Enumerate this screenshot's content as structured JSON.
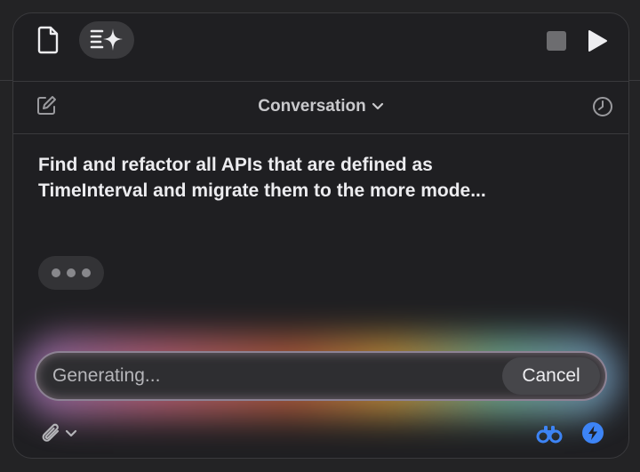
{
  "toolbar": {
    "left_icons": [
      "document-icon",
      "sparkle-text-icon"
    ],
    "right_icons": [
      "stop-icon",
      "play-icon"
    ]
  },
  "subbar": {
    "title": "Conversation",
    "left_icon": "compose-icon",
    "right_icon": "history-icon"
  },
  "conversation": {
    "message": "Find and refactor all APIs that are defined as\nTimeInterval and migrate them to the more mode..."
  },
  "input": {
    "status_text": "Generating...",
    "cancel_label": "Cancel"
  },
  "bottom": {
    "left_icons": [
      "paperclip-icon",
      "chevron-down-icon"
    ],
    "right_icons": [
      "binoculars-icon",
      "bolt-icon"
    ]
  },
  "colors": {
    "panel_bg": "#1f1f22",
    "accent_blue": "#3d84f5",
    "text_primary": "#ececef"
  }
}
